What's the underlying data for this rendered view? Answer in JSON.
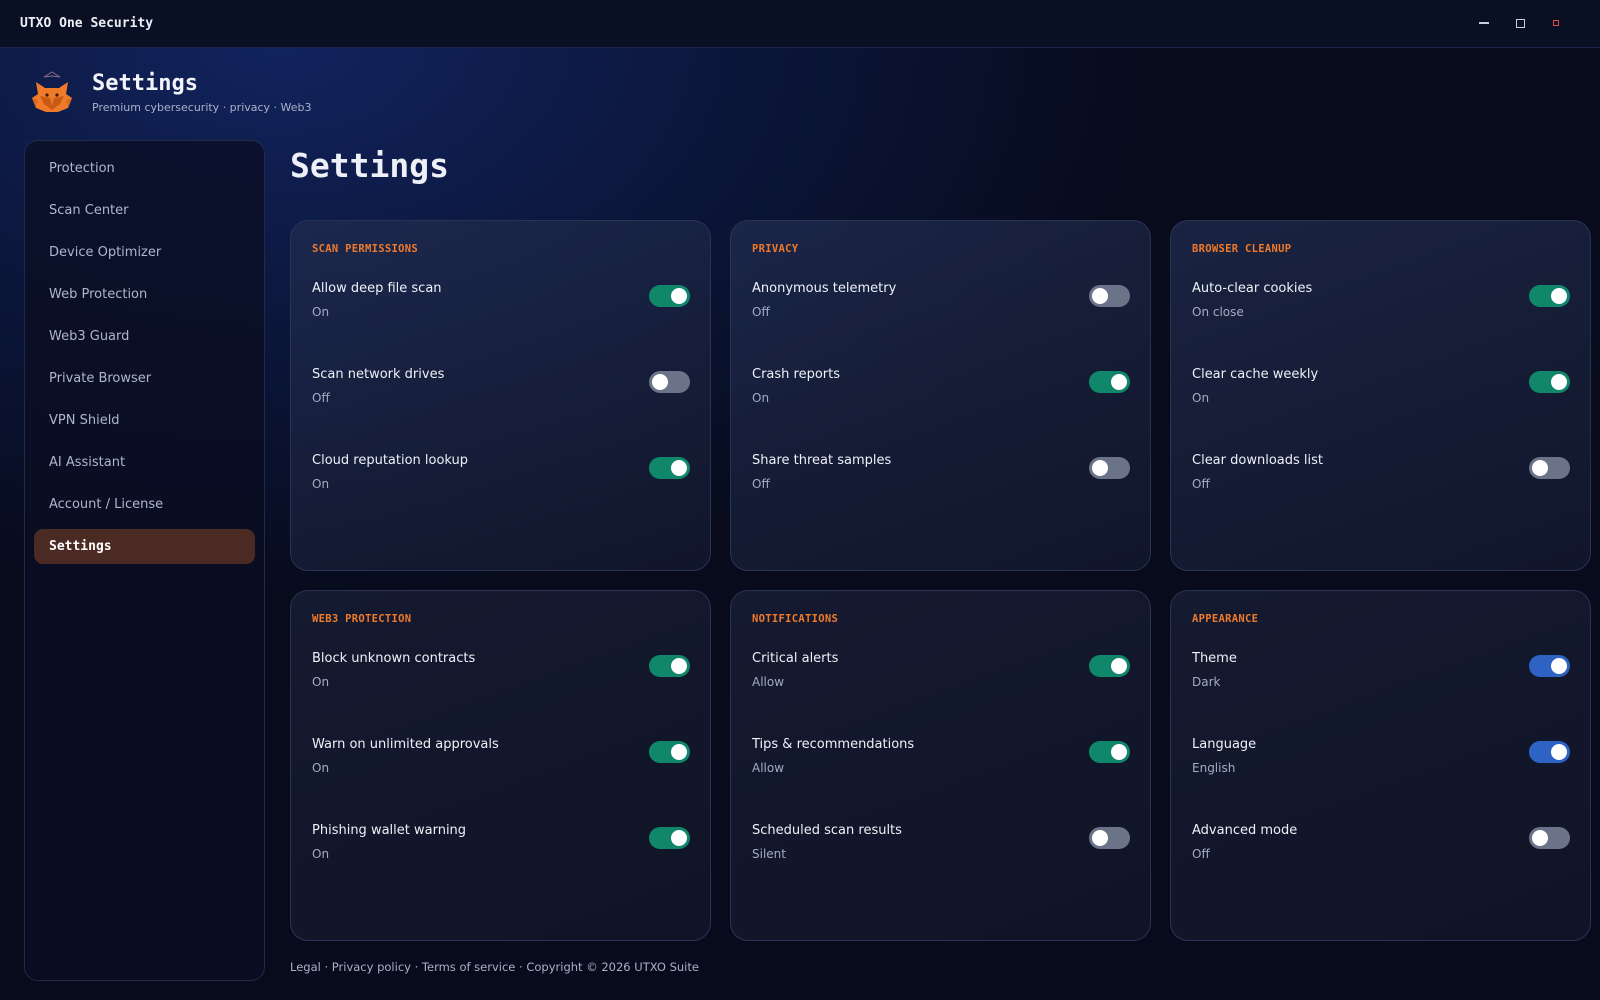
{
  "window": {
    "title": "UTXO One Security",
    "minimize_icon": "minimize-icon",
    "maximize_icon": "maximize-icon",
    "close_icon": "close-icon",
    "close_color": "#e24848"
  },
  "header": {
    "title": "Settings",
    "subtitle": "Premium cybersecurity · privacy · Web3",
    "logo_icon": "fox-logo-icon",
    "logo_color": "#ee7a2a"
  },
  "sidebar": {
    "items": [
      {
        "label": "Protection"
      },
      {
        "label": "Scan Center"
      },
      {
        "label": "Device Optimizer"
      },
      {
        "label": "Web Protection"
      },
      {
        "label": "Web3 Guard"
      },
      {
        "label": "Private Browser"
      },
      {
        "label": "VPN Shield"
      },
      {
        "label": "AI Assistant"
      },
      {
        "label": "Account / License"
      },
      {
        "label": "Settings",
        "active": true
      }
    ],
    "active_color": "#4a2a22"
  },
  "main": {
    "title": "Settings",
    "accent_color": "#ee7a2a",
    "toggle_on_color": "#10876a",
    "toggle_on_alt_color": "#2e63c4",
    "toggle_off_color": "#6b7388",
    "cards": [
      {
        "heading": "SCAN PERMISSIONS",
        "rows": [
          {
            "label": "Allow deep file scan",
            "value": "On",
            "enabled": true
          },
          {
            "label": "Scan network drives",
            "value": "Off",
            "enabled": false
          },
          {
            "label": "Cloud reputation lookup",
            "value": "On",
            "enabled": true
          }
        ]
      },
      {
        "heading": "PRIVACY",
        "rows": [
          {
            "label": "Anonymous telemetry",
            "value": "Off",
            "enabled": false
          },
          {
            "label": "Crash reports",
            "value": "On",
            "enabled": true
          },
          {
            "label": "Share threat samples",
            "value": "Off",
            "enabled": false
          }
        ]
      },
      {
        "heading": "BROWSER CLEANUP",
        "rows": [
          {
            "label": "Auto-clear cookies",
            "value": "On close",
            "enabled": true
          },
          {
            "label": "Clear cache weekly",
            "value": "On",
            "enabled": true
          },
          {
            "label": "Clear downloads list",
            "value": "Off",
            "enabled": false
          }
        ]
      },
      {
        "heading": "WEB3 PROTECTION",
        "rows": [
          {
            "label": "Block unknown contracts",
            "value": "On",
            "enabled": true
          },
          {
            "label": "Warn on unlimited approvals",
            "value": "On",
            "enabled": true
          },
          {
            "label": "Phishing wallet warning",
            "value": "On",
            "enabled": true
          }
        ]
      },
      {
        "heading": "NOTIFICATIONS",
        "rows": [
          {
            "label": "Critical alerts",
            "value": "Allow",
            "enabled": true
          },
          {
            "label": "Tips & recommendations",
            "value": "Allow",
            "enabled": true
          },
          {
            "label": "Scheduled scan results",
            "value": "Silent",
            "enabled": false
          }
        ]
      },
      {
        "heading": "APPEARANCE",
        "rows": [
          {
            "label": "Theme",
            "value": "Dark",
            "enabled": true,
            "style": "blue"
          },
          {
            "label": "Language",
            "value": "English",
            "enabled": true,
            "style": "blue"
          },
          {
            "label": "Advanced mode",
            "value": "Off",
            "enabled": false
          }
        ]
      }
    ]
  },
  "footer": {
    "legal": "Legal",
    "privacy": "Privacy policy",
    "terms": "Terms of service",
    "copyright": "Copyright © 2026 UTXO Suite",
    "separator": " · "
  }
}
